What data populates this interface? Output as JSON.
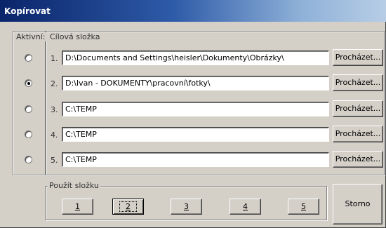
{
  "window": {
    "title": "Kopírovat"
  },
  "groups": {
    "active_label": "Aktivní:",
    "folder_label": "Cílová složka",
    "use_label": "Použít složku"
  },
  "rows": [
    {
      "number": "1.",
      "path": "D:\\Documents and Settings\\heisler\\Dokumenty\\Obrázky\\",
      "browse": "Procházet...",
      "selected": false
    },
    {
      "number": "2.",
      "path": "D:\\Ivan - DOKUMENTY\\pracovní\\fotky\\",
      "browse": "Procházet...",
      "selected": true
    },
    {
      "number": "3.",
      "path": "C:\\TEMP",
      "browse": "Procházet...",
      "selected": false
    },
    {
      "number": "4.",
      "path": "C:\\TEMP",
      "browse": "Procházet...",
      "selected": false
    },
    {
      "number": "5.",
      "path": "C:\\TEMP",
      "browse": "Procházet...",
      "selected": false
    }
  ],
  "use_buttons": [
    "1",
    "2",
    "3",
    "4",
    "5"
  ],
  "pressed_use_button": "2",
  "cancel_label": "Storno"
}
